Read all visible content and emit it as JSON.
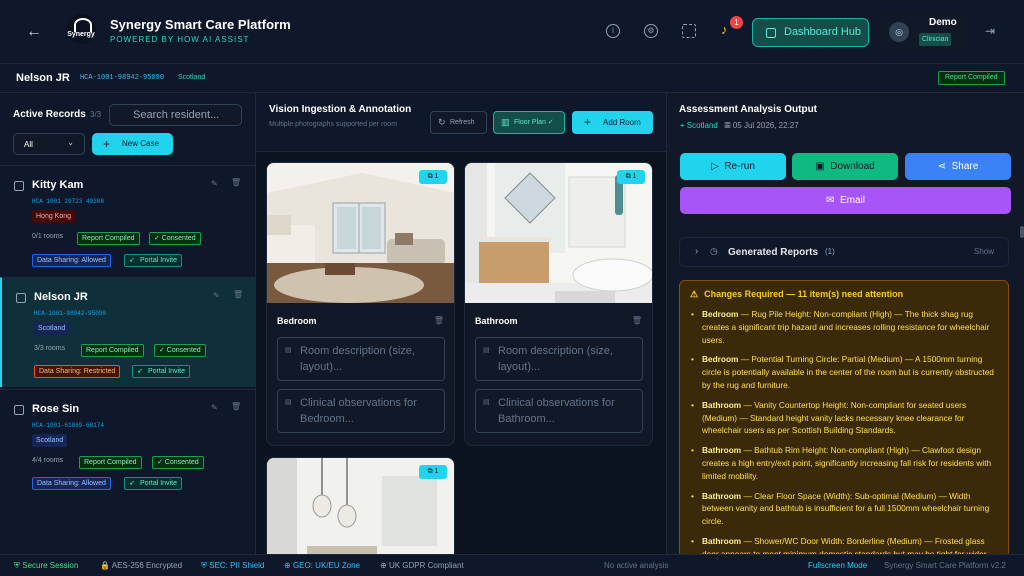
{
  "header": {
    "title": "Synergy Smart Care Platform",
    "subtitle": "POWERED BY HOW AI ASSIST",
    "logo_text": "Synergy",
    "notif_count": "1",
    "hub_label": "Dashboard Hub",
    "user_name": "Demo",
    "user_role": "Clinician"
  },
  "patient": {
    "name": "Nelson JR",
    "id": "HCA-1001-98942-95090",
    "region": "Scotland",
    "status": "Report Compiled"
  },
  "records": {
    "title": "Active Records",
    "count": "3/3",
    "search_placeholder": "Search resident...",
    "filter": "All",
    "new_case": "New Case",
    "cases": [
      {
        "name": "Kitty Kam",
        "id": "HCA 1001 29723 49308",
        "region": "Hong Kong",
        "rooms": "0/1 rooms",
        "report": "Report Compiled",
        "consent": "✓ Consented",
        "sharing": "Data Sharing: Allowed",
        "invite": "Portal Invite"
      },
      {
        "name": "Nelson JR",
        "id": "HCA-1001-98942-95090",
        "region": "Scotland",
        "rooms": "3/3 rooms",
        "report": "Report Compiled",
        "consent": "✓ Consented",
        "sharing": "Data Sharing: Restricted",
        "invite": "Portal Invite"
      },
      {
        "name": "Rose Sin",
        "id": "HCA-1001-61869-60174",
        "region": "Scotland",
        "rooms": "4/4 rooms",
        "report": "Report Compiled",
        "consent": "✓ Consented",
        "sharing": "Data Sharing: Allowed",
        "invite": "Portal Invite"
      }
    ]
  },
  "vision": {
    "title": "Vision Ingestion & Annotation",
    "subtitle": "Multiple photographs supported per room",
    "refresh": "Refresh",
    "floor_plan": "Floor Plan ✓",
    "add_room": "Add Room",
    "rooms": [
      {
        "name": "Bedroom",
        "photo_count": "1",
        "desc_placeholder": "Room description (size, layout)...",
        "obs_placeholder": "Clinical observations for Bedroom..."
      },
      {
        "name": "Bathroom",
        "photo_count": "1",
        "desc_placeholder": "Room description (size, layout)...",
        "obs_placeholder": "Clinical observations for Bathroom..."
      },
      {
        "name": "",
        "photo_count": "1"
      }
    ]
  },
  "analysis": {
    "title": "Assessment Analysis Output",
    "region": "Scotland",
    "date": "05 Jul 2026, 22:27",
    "rerun": "Re-run",
    "download": "Download",
    "share": "Share",
    "email": "Email",
    "reports_title": "Generated Reports",
    "reports_count": "(1)",
    "show": "Show",
    "alert_title": "Changes Required — 11 item(s) need attention",
    "items": [
      {
        "room": "Bedroom",
        "text": "— Rug Pile Height: Non-compliant (High) — The thick shag rug creates a significant trip hazard and increases rolling resistance for wheelchair users."
      },
      {
        "room": "Bedroom",
        "text": "— Potential Turning Circle: Partial (Medium) — A 1500mm turning circle is potentially available in the center of the room but is currently obstructed by the rug and furniture."
      },
      {
        "room": "Bathroom",
        "text": "— Vanity Countertop Height: Non-compliant for seated users (Medium) — Standard height vanity lacks necessary knee clearance for wheelchair users as per Scottish Building Standards."
      },
      {
        "room": "Bathroom",
        "text": "— Bathtub Rim Height: Non-compliant (High) — Clawfoot design creates a high entry/exit point, significantly increasing fall risk for residents with limited mobility."
      },
      {
        "room": "Bathroom",
        "text": "— Clear Floor Space (Width): Sub-optimal (Medium) — Width between vanity and bathtub is insufficient for a full 1500mm wheelchair turning circle."
      },
      {
        "room": "Bathroom",
        "text": "— Shower/WC Door Width: Borderline (Medium) — Frosted glass door appears to meet minimum domestic standards but may be tight for wider powered wheelchairs."
      }
    ]
  },
  "status": {
    "secure": "Secure Session",
    "aes": "AES-256 Encrypted",
    "sec": "SEC: PII Shield",
    "geo": "GEO: UK/EU Zone",
    "gdpr": "UK GDPR Compliant",
    "activity": "No active analysis",
    "fullscreen": "Fullscreen Mode",
    "version": "Synergy Smart Care Platform v2.2"
  },
  "colors": {
    "accent": "#22d3ee",
    "teal": "#2dd4bf",
    "download": "#10b981",
    "share": "#3b82f6",
    "email": "#a855f7",
    "warning": "#facc15"
  }
}
